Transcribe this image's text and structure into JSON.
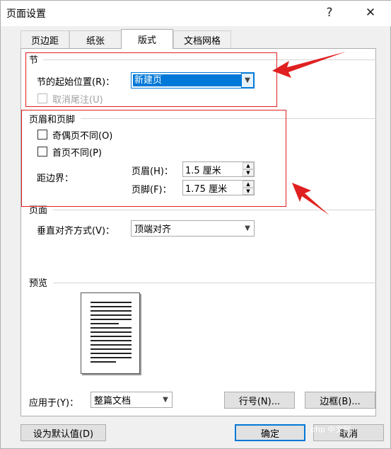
{
  "window": {
    "title": "页面设置",
    "help_glyph": "?",
    "close_glyph": "✕"
  },
  "tabs": [
    {
      "label": "页边距"
    },
    {
      "label": "纸张"
    },
    {
      "label": "版式",
      "active": true
    },
    {
      "label": "文档网格"
    }
  ],
  "section": {
    "group_label": "节",
    "start_label": "节的起始位置(R)：",
    "start_value": "新建页",
    "suppress_endnotes_label": "取消尾注(U)",
    "suppress_endnotes_checked": false,
    "suppress_endnotes_enabled": false
  },
  "header_footer": {
    "group_label": "页眉和页脚",
    "odd_even_label": "奇偶页不同(O)",
    "odd_even_checked": false,
    "first_page_label": "首页不同(P)",
    "first_page_checked": false,
    "from_edge_label": "距边界：",
    "header_label": "页眉(H)：",
    "header_value": "1.5 厘米",
    "footer_label": "页脚(F)：",
    "footer_value": "1.75 厘米"
  },
  "page": {
    "group_label": "页面",
    "valign_label": "垂直对齐方式(V)：",
    "valign_value": "顶端对齐"
  },
  "preview": {
    "group_label": "预览"
  },
  "apply": {
    "label": "应用于(Y)：",
    "value": "整篇文档"
  },
  "buttons": {
    "line_numbers": "行号(N)...",
    "borders": "边框(B)...",
    "set_default": "设为默认值(D)",
    "ok": "确定",
    "cancel": "取消"
  },
  "watermark": "php 中文网",
  "colors": {
    "accent": "#0078d7",
    "annotation": "#e02020"
  }
}
